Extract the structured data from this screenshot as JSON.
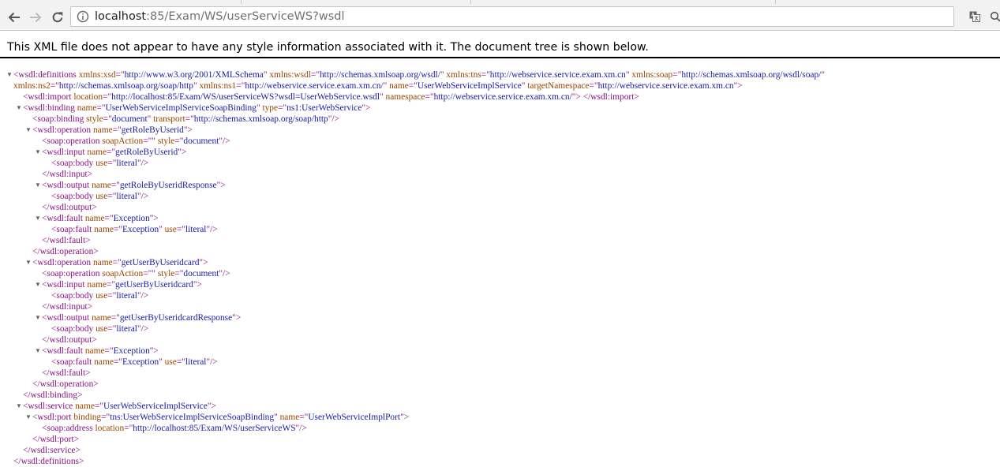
{
  "browser": {
    "url_host": "localhost",
    "url_path": ":85/Exam/WS/userServiceWS?wsdl"
  },
  "xml_viewer": {
    "info_message": "This XML file does not appear to have any style information associated with it. The document tree is shown below.",
    "collapse_glyph": "▼",
    "lines": [
      {
        "indent": 1,
        "toggle": true,
        "parts": [
          [
            "t",
            "<wsdl:definitions "
          ],
          [
            "a",
            "xmlns:xsd"
          ],
          [
            "t",
            "=\""
          ],
          [
            "v",
            "http://www.w3.org/2001/XMLSchema"
          ],
          [
            "t",
            "\" "
          ],
          [
            "a",
            "xmlns:wsdl"
          ],
          [
            "t",
            "=\""
          ],
          [
            "v",
            "http://schemas.xmlsoap.org/wsdl/"
          ],
          [
            "t",
            "\" "
          ],
          [
            "a",
            "xmlns:tns"
          ],
          [
            "t",
            "=\""
          ],
          [
            "v",
            "http://webservice.service.exam.xm.cn"
          ],
          [
            "t",
            "\" "
          ],
          [
            "a",
            "xmlns:soap"
          ],
          [
            "t",
            "=\""
          ],
          [
            "v",
            "http://schemas.xmlsoap.org/wsdl/soap/"
          ],
          [
            "t",
            "\""
          ]
        ]
      },
      {
        "indent": 1,
        "toggle": false,
        "parts": [
          [
            "a",
            "xmlns:ns2"
          ],
          [
            "t",
            "=\""
          ],
          [
            "v",
            "http://schemas.xmlsoap.org/soap/http"
          ],
          [
            "t",
            "\" "
          ],
          [
            "a",
            "xmlns:ns1"
          ],
          [
            "t",
            "=\""
          ],
          [
            "v",
            "http://webservice.service.exam.xm.cn/"
          ],
          [
            "t",
            "\" "
          ],
          [
            "a",
            "name"
          ],
          [
            "t",
            "=\""
          ],
          [
            "v",
            "UserWebServiceImplService"
          ],
          [
            "t",
            "\" "
          ],
          [
            "a",
            "targetNamespace"
          ],
          [
            "t",
            "=\""
          ],
          [
            "v",
            "http://webservice.service.exam.xm.cn"
          ],
          [
            "t",
            "\">"
          ]
        ]
      },
      {
        "indent": 2,
        "toggle": false,
        "parts": [
          [
            "t",
            "<wsdl:import "
          ],
          [
            "a",
            "location"
          ],
          [
            "t",
            "=\""
          ],
          [
            "v",
            "http://localhost:85/Exam/WS/userServiceWS?wsdl=UserWebService.wsdl"
          ],
          [
            "t",
            "\" "
          ],
          [
            "a",
            "namespace"
          ],
          [
            "t",
            "=\""
          ],
          [
            "v",
            "http://webservice.service.exam.xm.cn/"
          ],
          [
            "t",
            "\"> </wsdl:import>"
          ]
        ]
      },
      {
        "indent": 2,
        "toggle": true,
        "parts": [
          [
            "t",
            "<wsdl:binding "
          ],
          [
            "a",
            "name"
          ],
          [
            "t",
            "=\""
          ],
          [
            "v",
            "UserWebServiceImplServiceSoapBinding"
          ],
          [
            "t",
            "\" "
          ],
          [
            "a",
            "type"
          ],
          [
            "t",
            "=\""
          ],
          [
            "v",
            "ns1:UserWebService"
          ],
          [
            "t",
            "\">"
          ]
        ]
      },
      {
        "indent": 3,
        "toggle": false,
        "parts": [
          [
            "t",
            "<soap:binding "
          ],
          [
            "a",
            "style"
          ],
          [
            "t",
            "=\""
          ],
          [
            "v",
            "document"
          ],
          [
            "t",
            "\" "
          ],
          [
            "a",
            "transport"
          ],
          [
            "t",
            "=\""
          ],
          [
            "v",
            "http://schemas.xmlsoap.org/soap/http"
          ],
          [
            "t",
            "\"/>"
          ]
        ]
      },
      {
        "indent": 3,
        "toggle": true,
        "parts": [
          [
            "t",
            "<wsdl:operation "
          ],
          [
            "a",
            "name"
          ],
          [
            "t",
            "=\""
          ],
          [
            "v",
            "getRoleByUserid"
          ],
          [
            "t",
            "\">"
          ]
        ]
      },
      {
        "indent": 4,
        "toggle": false,
        "parts": [
          [
            "t",
            "<soap:operation "
          ],
          [
            "a",
            "soapAction"
          ],
          [
            "t",
            "=\"\" "
          ],
          [
            "a",
            "style"
          ],
          [
            "t",
            "=\""
          ],
          [
            "v",
            "document"
          ],
          [
            "t",
            "\"/>"
          ]
        ]
      },
      {
        "indent": 4,
        "toggle": true,
        "parts": [
          [
            "t",
            "<wsdl:input "
          ],
          [
            "a",
            "name"
          ],
          [
            "t",
            "=\""
          ],
          [
            "v",
            "getRoleByUserid"
          ],
          [
            "t",
            "\">"
          ]
        ]
      },
      {
        "indent": 5,
        "toggle": false,
        "parts": [
          [
            "t",
            "<soap:body "
          ],
          [
            "a",
            "use"
          ],
          [
            "t",
            "=\""
          ],
          [
            "v",
            "literal"
          ],
          [
            "t",
            "\"/>"
          ]
        ]
      },
      {
        "indent": 4,
        "toggle": false,
        "parts": [
          [
            "t",
            "</wsdl:input>"
          ]
        ]
      },
      {
        "indent": 4,
        "toggle": true,
        "parts": [
          [
            "t",
            "<wsdl:output "
          ],
          [
            "a",
            "name"
          ],
          [
            "t",
            "=\""
          ],
          [
            "v",
            "getRoleByUseridResponse"
          ],
          [
            "t",
            "\">"
          ]
        ]
      },
      {
        "indent": 5,
        "toggle": false,
        "parts": [
          [
            "t",
            "<soap:body "
          ],
          [
            "a",
            "use"
          ],
          [
            "t",
            "=\""
          ],
          [
            "v",
            "literal"
          ],
          [
            "t",
            "\"/>"
          ]
        ]
      },
      {
        "indent": 4,
        "toggle": false,
        "parts": [
          [
            "t",
            "</wsdl:output>"
          ]
        ]
      },
      {
        "indent": 4,
        "toggle": true,
        "parts": [
          [
            "t",
            "<wsdl:fault "
          ],
          [
            "a",
            "name"
          ],
          [
            "t",
            "=\""
          ],
          [
            "v",
            "Exception"
          ],
          [
            "t",
            "\">"
          ]
        ]
      },
      {
        "indent": 5,
        "toggle": false,
        "parts": [
          [
            "t",
            "<soap:fault "
          ],
          [
            "a",
            "name"
          ],
          [
            "t",
            "=\""
          ],
          [
            "v",
            "Exception"
          ],
          [
            "t",
            "\" "
          ],
          [
            "a",
            "use"
          ],
          [
            "t",
            "=\""
          ],
          [
            "v",
            "literal"
          ],
          [
            "t",
            "\"/>"
          ]
        ]
      },
      {
        "indent": 4,
        "toggle": false,
        "parts": [
          [
            "t",
            "</wsdl:fault>"
          ]
        ]
      },
      {
        "indent": 3,
        "toggle": false,
        "parts": [
          [
            "t",
            "</wsdl:operation>"
          ]
        ]
      },
      {
        "indent": 3,
        "toggle": true,
        "parts": [
          [
            "t",
            "<wsdl:operation "
          ],
          [
            "a",
            "name"
          ],
          [
            "t",
            "=\""
          ],
          [
            "v",
            "getUserByUseridcard"
          ],
          [
            "t",
            "\">"
          ]
        ]
      },
      {
        "indent": 4,
        "toggle": false,
        "parts": [
          [
            "t",
            "<soap:operation "
          ],
          [
            "a",
            "soapAction"
          ],
          [
            "t",
            "=\"\" "
          ],
          [
            "a",
            "style"
          ],
          [
            "t",
            "=\""
          ],
          [
            "v",
            "document"
          ],
          [
            "t",
            "\"/>"
          ]
        ]
      },
      {
        "indent": 4,
        "toggle": true,
        "parts": [
          [
            "t",
            "<wsdl:input "
          ],
          [
            "a",
            "name"
          ],
          [
            "t",
            "=\""
          ],
          [
            "v",
            "getUserByUseridcard"
          ],
          [
            "t",
            "\">"
          ]
        ]
      },
      {
        "indent": 5,
        "toggle": false,
        "parts": [
          [
            "t",
            "<soap:body "
          ],
          [
            "a",
            "use"
          ],
          [
            "t",
            "=\""
          ],
          [
            "v",
            "literal"
          ],
          [
            "t",
            "\"/>"
          ]
        ]
      },
      {
        "indent": 4,
        "toggle": false,
        "parts": [
          [
            "t",
            "</wsdl:input>"
          ]
        ]
      },
      {
        "indent": 4,
        "toggle": true,
        "parts": [
          [
            "t",
            "<wsdl:output "
          ],
          [
            "a",
            "name"
          ],
          [
            "t",
            "=\""
          ],
          [
            "v",
            "getUserByUseridcardResponse"
          ],
          [
            "t",
            "\">"
          ]
        ]
      },
      {
        "indent": 5,
        "toggle": false,
        "parts": [
          [
            "t",
            "<soap:body "
          ],
          [
            "a",
            "use"
          ],
          [
            "t",
            "=\""
          ],
          [
            "v",
            "literal"
          ],
          [
            "t",
            "\"/>"
          ]
        ]
      },
      {
        "indent": 4,
        "toggle": false,
        "parts": [
          [
            "t",
            "</wsdl:output>"
          ]
        ]
      },
      {
        "indent": 4,
        "toggle": true,
        "parts": [
          [
            "t",
            "<wsdl:fault "
          ],
          [
            "a",
            "name"
          ],
          [
            "t",
            "=\""
          ],
          [
            "v",
            "Exception"
          ],
          [
            "t",
            "\">"
          ]
        ]
      },
      {
        "indent": 5,
        "toggle": false,
        "parts": [
          [
            "t",
            "<soap:fault "
          ],
          [
            "a",
            "name"
          ],
          [
            "t",
            "=\""
          ],
          [
            "v",
            "Exception"
          ],
          [
            "t",
            "\" "
          ],
          [
            "a",
            "use"
          ],
          [
            "t",
            "=\""
          ],
          [
            "v",
            "literal"
          ],
          [
            "t",
            "\"/>"
          ]
        ]
      },
      {
        "indent": 4,
        "toggle": false,
        "parts": [
          [
            "t",
            "</wsdl:fault>"
          ]
        ]
      },
      {
        "indent": 3,
        "toggle": false,
        "parts": [
          [
            "t",
            "</wsdl:operation>"
          ]
        ]
      },
      {
        "indent": 2,
        "toggle": false,
        "parts": [
          [
            "t",
            "</wsdl:binding>"
          ]
        ]
      },
      {
        "indent": 2,
        "toggle": true,
        "parts": [
          [
            "t",
            "<wsdl:service "
          ],
          [
            "a",
            "name"
          ],
          [
            "t",
            "=\""
          ],
          [
            "v",
            "UserWebServiceImplService"
          ],
          [
            "t",
            "\">"
          ]
        ]
      },
      {
        "indent": 3,
        "toggle": true,
        "parts": [
          [
            "t",
            "<wsdl:port "
          ],
          [
            "a",
            "binding"
          ],
          [
            "t",
            "=\""
          ],
          [
            "v",
            "tns:UserWebServiceImplServiceSoapBinding"
          ],
          [
            "t",
            "\" "
          ],
          [
            "a",
            "name"
          ],
          [
            "t",
            "=\""
          ],
          [
            "v",
            "UserWebServiceImplPort"
          ],
          [
            "t",
            "\">"
          ]
        ]
      },
      {
        "indent": 4,
        "toggle": false,
        "parts": [
          [
            "t",
            "<soap:address "
          ],
          [
            "a",
            "location"
          ],
          [
            "t",
            "=\""
          ],
          [
            "v",
            "http://localhost:85/Exam/WS/userServiceWS"
          ],
          [
            "t",
            "\"/>"
          ]
        ]
      },
      {
        "indent": 3,
        "toggle": false,
        "parts": [
          [
            "t",
            "</wsdl:port>"
          ]
        ]
      },
      {
        "indent": 2,
        "toggle": false,
        "parts": [
          [
            "t",
            "</wsdl:service>"
          ]
        ]
      },
      {
        "indent": 1,
        "toggle": false,
        "parts": [
          [
            "t",
            "</wsdl:definitions>"
          ]
        ]
      }
    ]
  }
}
